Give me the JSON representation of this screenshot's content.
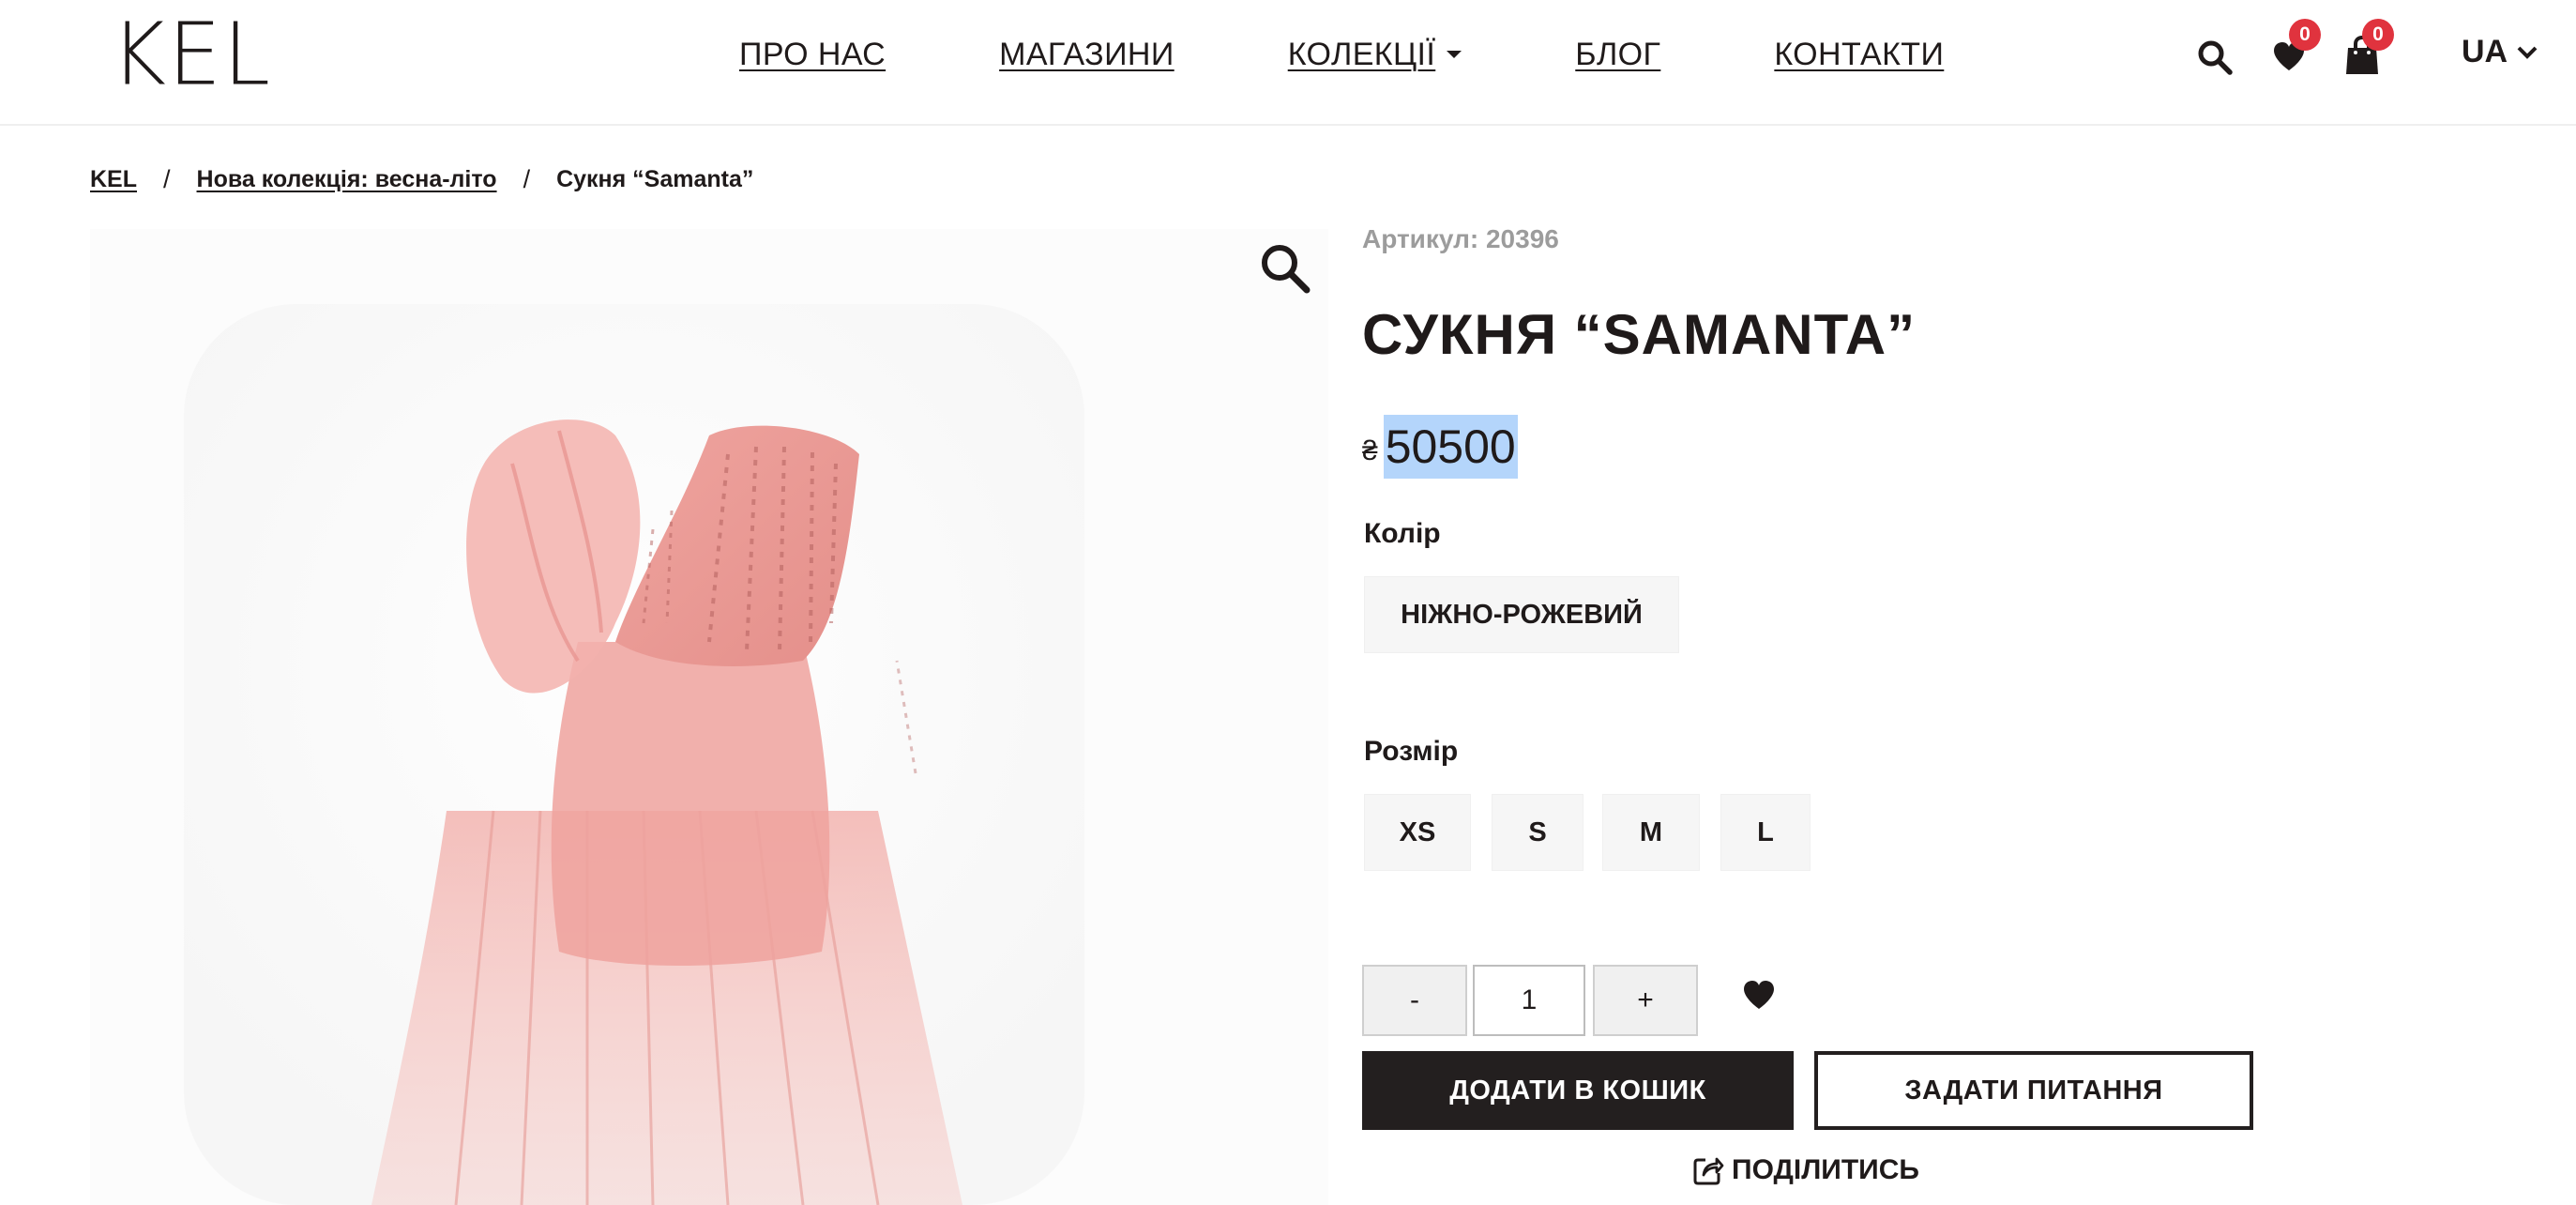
{
  "header": {
    "logo": "KEL",
    "nav": [
      {
        "label": "ПРО НАС"
      },
      {
        "label": "МАГАЗИНИ"
      },
      {
        "label": "КОЛЕКЦІЇ"
      },
      {
        "label": "БЛОГ"
      },
      {
        "label": "КОНТАКТИ"
      }
    ],
    "wishlist_count": "0",
    "cart_count": "0",
    "language": "UA",
    "icons": [
      "search-icon",
      "heart-icon",
      "shopping-bag-icon",
      "chevron-down-icon"
    ]
  },
  "breadcrumb": {
    "home": "KEL",
    "collection": "Нова колекція: весна-літо",
    "current": "Сукня “Samanta”",
    "separator": "/"
  },
  "product": {
    "sku": "Артикул: 20396",
    "title": "СУКНЯ “SAMANTA”",
    "currency_symbol": "₴",
    "price": "50500",
    "color_label": "Колір",
    "color_value": "НІЖНО-РОЖЕВИЙ",
    "size_label": "Розмір",
    "sizes": [
      "XS",
      "S",
      "M",
      "L"
    ],
    "quantity": "1",
    "minus_label": "-",
    "plus_label": "+",
    "add_to_cart": "ДОДАТИ В КОШИК",
    "ask_question": "ЗАДАТИ ПИТАННЯ",
    "share": "ПОДІЛИТИСЬ"
  },
  "colors": {
    "text": "#1f1a1a",
    "badge": "#e0333e",
    "muted": "#9c9c9c",
    "chip_bg": "#f6f6f6",
    "primary_button": "#231f1f",
    "selection_highlight": "#b4d5fb",
    "dress": "#f0a9a4"
  }
}
